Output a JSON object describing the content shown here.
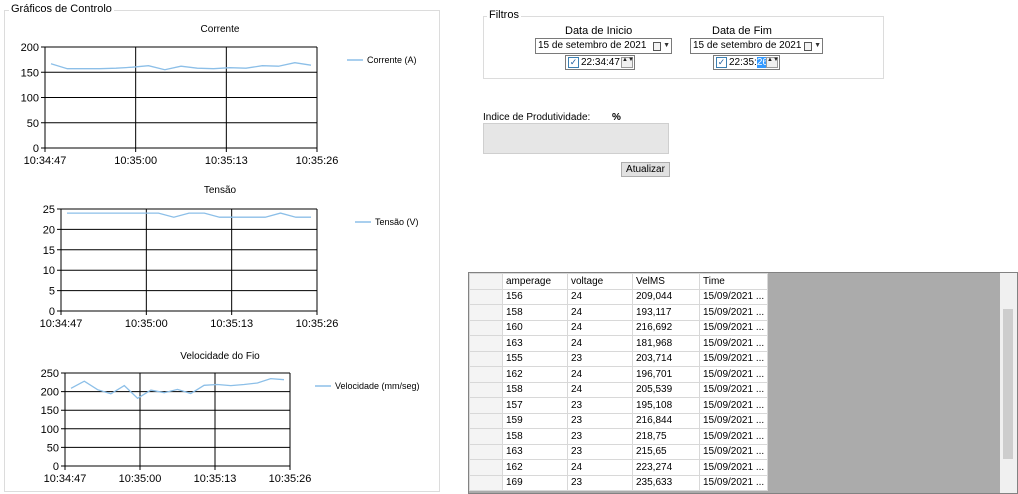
{
  "charts_group": {
    "title": "Gráficos de Controlo",
    "charts": [
      {
        "title": "Corrente",
        "legend": "Corrente (A)",
        "y_ticks": [
          "200",
          "150",
          "100",
          "50",
          "0"
        ],
        "x_ticks": [
          "10:34:47",
          "10:35:00",
          "10:35:13",
          "10:35:26"
        ]
      },
      {
        "title": "Tensão",
        "legend": "Tensão (V)",
        "y_ticks": [
          "25",
          "20",
          "15",
          "10",
          "5",
          "0"
        ],
        "x_ticks": [
          "10:34:47",
          "10:35:00",
          "10:35:13",
          "10:35:26"
        ]
      },
      {
        "title": "Velocidade do Fio",
        "legend": "Velocidade (mm/seg)",
        "y_ticks": [
          "250",
          "200",
          "150",
          "100",
          "50",
          "0"
        ],
        "x_ticks": [
          "10:34:47",
          "10:35:00",
          "10:35:13",
          "10:35:26"
        ]
      }
    ]
  },
  "chart_data": [
    {
      "type": "line",
      "title": "Corrente",
      "ylim": [
        0,
        200
      ],
      "x": [
        "10:34:47",
        "10:35:00",
        "10:35:13",
        "10:35:26"
      ],
      "series": [
        {
          "name": "Corrente (A)",
          "color": "#8cbfe8",
          "values": [
            167,
            157,
            157,
            157,
            158,
            160,
            163,
            155,
            162,
            158,
            157,
            159,
            158,
            163,
            162,
            169,
            164
          ]
        }
      ]
    },
    {
      "type": "line",
      "title": "Tensão",
      "ylim": [
        0,
        25
      ],
      "x": [
        "10:34:47",
        "10:35:00",
        "10:35:13",
        "10:35:26"
      ],
      "series": [
        {
          "name": "Tensão (V)",
          "color": "#8cbfe8",
          "values": [
            24,
            24,
            24,
            24,
            24,
            24,
            24,
            23,
            24,
            24,
            23,
            23,
            23,
            23,
            24,
            23,
            23
          ]
        }
      ]
    },
    {
      "type": "line",
      "title": "Velocidade do Fio",
      "ylim": [
        0,
        250
      ],
      "x": [
        "10:34:47",
        "10:35:00",
        "10:35:13",
        "10:35:26"
      ],
      "series": [
        {
          "name": "Velocidade (mm/seg)",
          "color": "#8cbfe8",
          "values": [
            209,
            228,
            205,
            194,
            216,
            182,
            204,
            197,
            206,
            195,
            217,
            219,
            216,
            219,
            223,
            235,
            232
          ]
        }
      ]
    }
  ],
  "filters": {
    "title": "Filtros",
    "start_label": "Data de Inicio",
    "end_label": "Data de Fim",
    "start_date": "15 de setembro de 2021",
    "end_date": "15 de setembro de 2021",
    "start_time": "22:34:47",
    "end_time_prefix": "22:35:",
    "end_time_selected": "26",
    "spin_glyph": "▲▼",
    "check_glyph": "✓",
    "dropdown_glyph": "▼"
  },
  "productivity": {
    "label": "Indice de Produtividade:",
    "unit": "%",
    "value": ""
  },
  "update_button": "Atualizar",
  "table": {
    "columns": [
      "amperage",
      "voltage",
      "VelMS",
      "Time"
    ],
    "rows": [
      [
        "156",
        "24",
        "209,044",
        "15/09/2021 ..."
      ],
      [
        "158",
        "24",
        "193,117",
        "15/09/2021 ..."
      ],
      [
        "160",
        "24",
        "216,692",
        "15/09/2021 ..."
      ],
      [
        "163",
        "24",
        "181,968",
        "15/09/2021 ..."
      ],
      [
        "155",
        "23",
        "203,714",
        "15/09/2021 ..."
      ],
      [
        "162",
        "24",
        "196,701",
        "15/09/2021 ..."
      ],
      [
        "158",
        "24",
        "205,539",
        "15/09/2021 ..."
      ],
      [
        "157",
        "23",
        "195,108",
        "15/09/2021 ..."
      ],
      [
        "159",
        "23",
        "216,844",
        "15/09/2021 ..."
      ],
      [
        "158",
        "23",
        "218,75",
        "15/09/2021 ..."
      ],
      [
        "163",
        "23",
        "215,65",
        "15/09/2021 ..."
      ],
      [
        "162",
        "24",
        "223,274",
        "15/09/2021 ..."
      ],
      [
        "169",
        "23",
        "235,633",
        "15/09/2021 ..."
      ]
    ]
  }
}
